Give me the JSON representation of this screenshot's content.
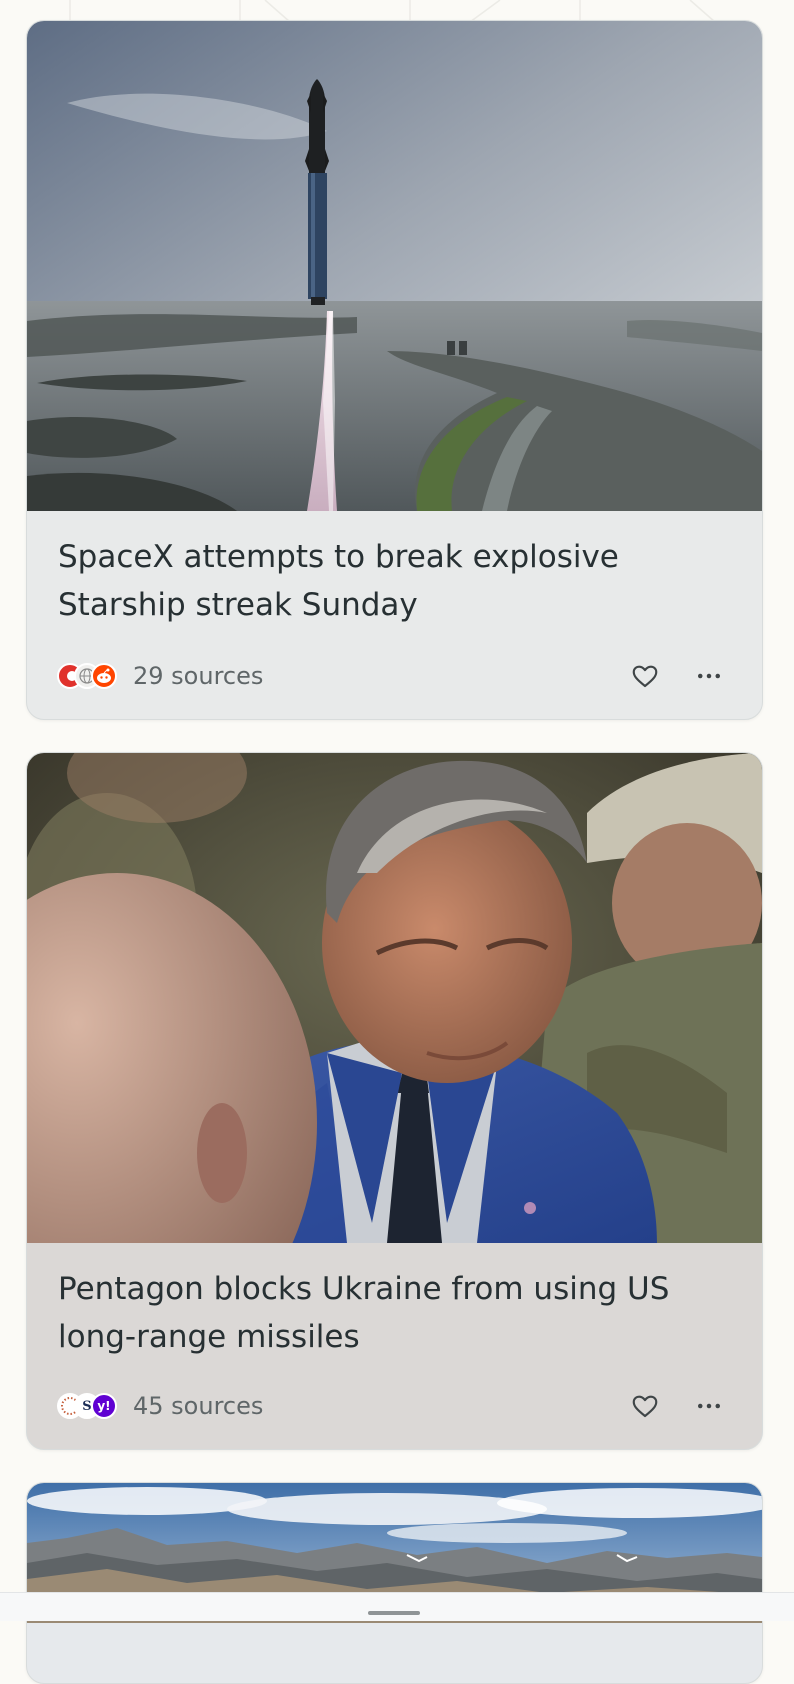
{
  "feed": {
    "cards": [
      {
        "headline": "SpaceX attempts to break explosive Starship streak Sunday",
        "sources_label": "29 sources",
        "source_icons": [
          "red-news-source-icon",
          "globe-source-icon",
          "reddit-icon"
        ],
        "image": "starship-launch-photo"
      },
      {
        "headline": "Pentagon blocks Ukraine from using US long-range missiles",
        "sources_label": "45 sources",
        "source_icons": [
          "dotted-circle-source-icon",
          "s-source-icon",
          "yahoo-icon"
        ],
        "image": "man-in-blue-suit-photo"
      },
      {
        "image": "mountain-range-photo"
      }
    ]
  },
  "icons": {
    "like": "heart-icon",
    "more": "more-options-icon"
  },
  "colors": {
    "page_background": "#fbfaf6",
    "card1_background": "#e8eaea",
    "card2_background": "#dbd8d6",
    "reddit": "#ff4500",
    "yahoo": "#6001d2"
  }
}
